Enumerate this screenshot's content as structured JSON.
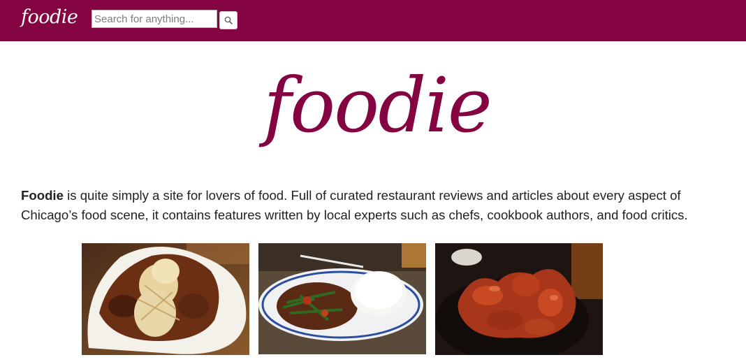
{
  "header": {
    "logo": "foodie",
    "search_placeholder": "Search for anything...",
    "background_color": "#840442",
    "search_button_icon": "search-icon"
  },
  "hero": {
    "logo_text": "foodie",
    "color": "#840442"
  },
  "intro": {
    "bold": "Foodie",
    "line1_rest": " is quite simply a site for lovers of food. Full of curated restaurant reviews and articles about every aspect of",
    "line2": "Chicago’s food scene, it contains features written by local experts such as chefs, cookbook authors, and food critics."
  },
  "gallery": {
    "photos": [
      "food-photo-kebabs-rice",
      "food-photo-stirfry-rice",
      "food-photo-chicken-wings"
    ]
  }
}
